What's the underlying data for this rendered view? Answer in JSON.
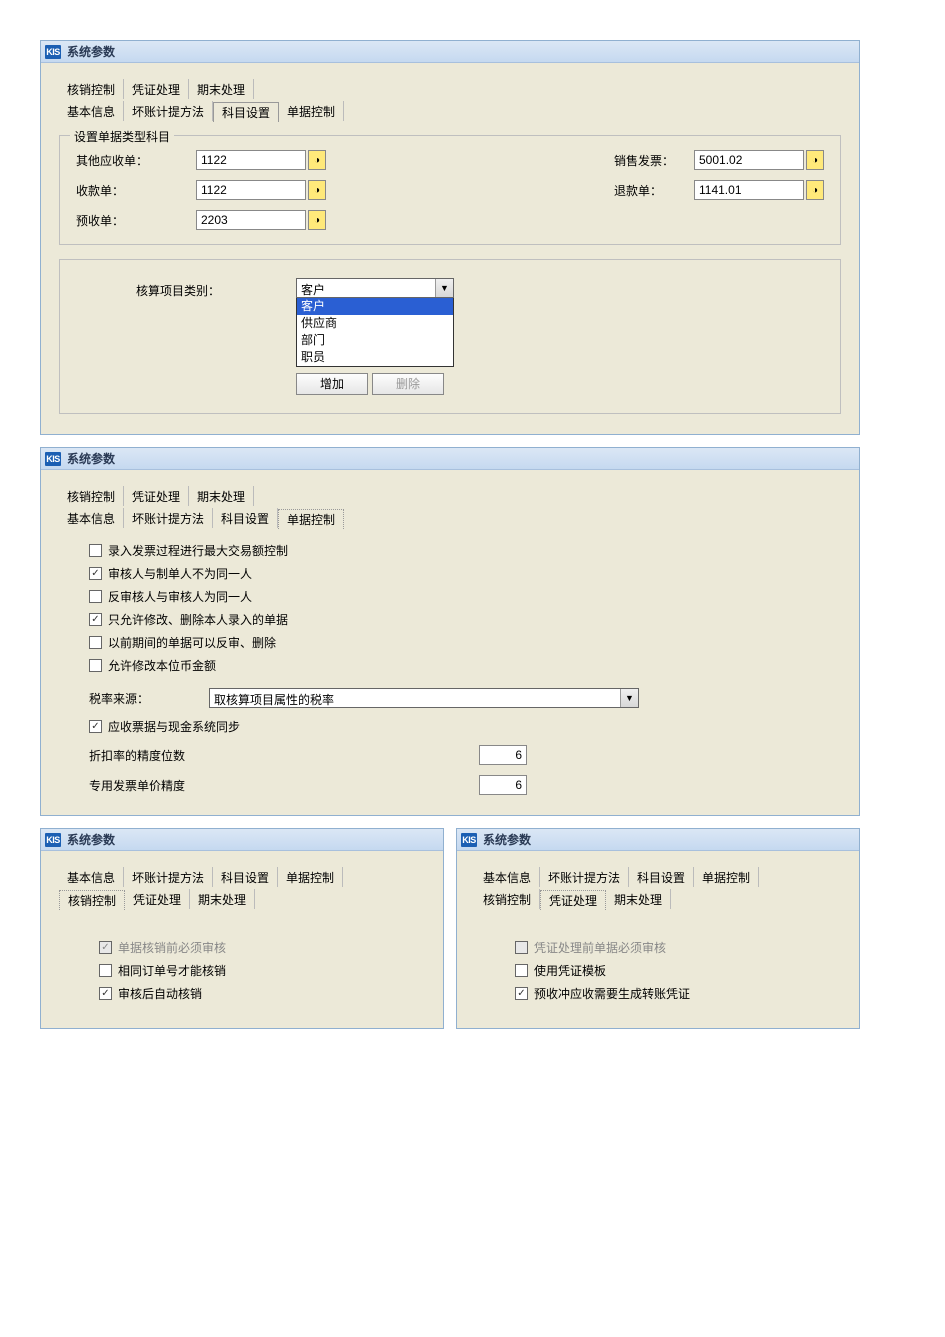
{
  "app_icon": "KIS",
  "win_title": "系统参数",
  "tabs_top": [
    "核销控制",
    "凭证处理",
    "期末处理"
  ],
  "tabs_bottom": [
    "基本信息",
    "坏账计提方法",
    "科目设置",
    "单据控制"
  ],
  "panel1": {
    "fieldset_title": "设置单据类型科目",
    "rows": {
      "other_recv_label": "其他应收单：",
      "other_recv_val": "1122",
      "sales_invoice_label": "销售发票：",
      "sales_invoice_val": "5001.02",
      "receipt_label": "收款单：",
      "receipt_val": "1122",
      "refund_label": "退款单：",
      "refund_val": "1141.01",
      "prepay_label": "预收单：",
      "prepay_val": "2203"
    },
    "category_label": "核算项目类别：",
    "dd_value": "客户",
    "dd_options": [
      "客户",
      "供应商",
      "部门",
      "职员"
    ],
    "btn_add": "增加",
    "btn_del": "删除"
  },
  "panel2": {
    "checks": {
      "c1": "录入发票过程进行最大交易额控制",
      "c2": "审核人与制单人不为同一人",
      "c3": "反审核人与审核人为同一人",
      "c4": "只允许修改、删除本人录入的单据",
      "c5": "以前期间的单据可以反审、删除",
      "c6": "允许修改本位币金额"
    },
    "tax_label": "税率来源：",
    "tax_value": "取核算项目属性的税率",
    "sync_label": "应收票据与现金系统同步",
    "disc_prec_label": "折扣率的精度位数",
    "disc_prec_val": "6",
    "inv_prec_label": "专用发票单价精度",
    "inv_prec_val": "6"
  },
  "panel3": {
    "checks": {
      "c1": "单据核销前必须审核",
      "c2": "相同订单号才能核销",
      "c3": "审核后自动核销"
    }
  },
  "panel4": {
    "checks": {
      "c1": "凭证处理前单据必须审核",
      "c2": "使用凭证模板",
      "c3": "预收冲应收需要生成转账凭证"
    }
  }
}
